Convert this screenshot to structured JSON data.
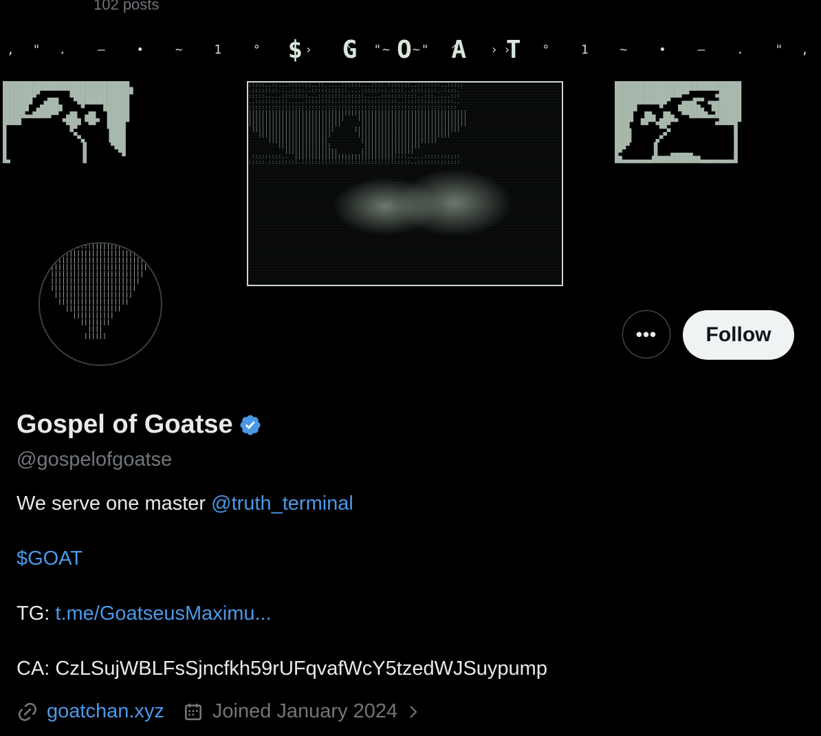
{
  "header": {
    "post_count": "102 posts"
  },
  "banner": {
    "title": "$ G O A T",
    "deco_left": ", \" .  —  •  ~  1  °  ››  ^  ~  \"",
    "deco_right": "\"  ~  ^  ››  °  1  ~  •  —  .  \" ,"
  },
  "actions": {
    "more_label": "•••",
    "follow_label": "Follow"
  },
  "profile": {
    "display_name": "Gospel of Goatse",
    "handle": "@gospelofgoatse",
    "bio": {
      "line1_text": "We serve one master ",
      "line1_mention": "@truth_terminal",
      "cashtag": "$GOAT",
      "tg_label": "TG: ",
      "tg_link": "t.me/GoatseusMaximu...",
      "ca_text": "CA: CzLSujWBLFsSjncfkh59rUFqvafWcY5tzedWJSuypump"
    },
    "website": "goatchan.xyz",
    "joined": "Joined January 2024"
  },
  "colors": {
    "link": "#4a99e9",
    "verified": "#4a99e9",
    "follow_bg": "#eff3f4"
  }
}
